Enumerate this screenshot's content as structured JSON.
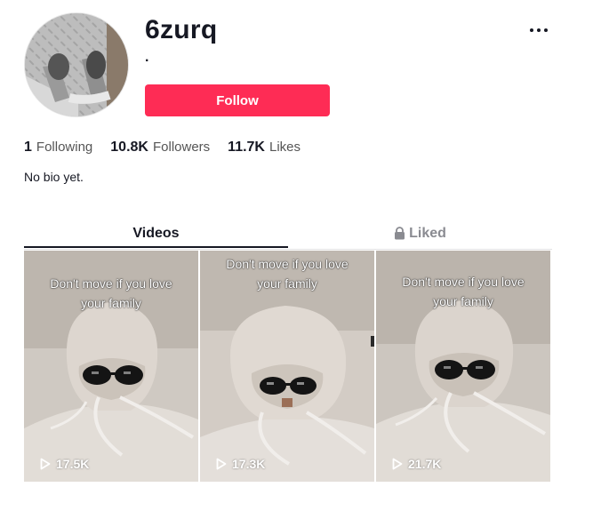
{
  "profile": {
    "username": "6zurq",
    "nickname": ".",
    "follow_label": "Follow",
    "bio": "No bio yet."
  },
  "stats": [
    {
      "value": "1",
      "label": "Following"
    },
    {
      "value": "10.8K",
      "label": "Followers"
    },
    {
      "value": "11.7K",
      "label": "Likes"
    }
  ],
  "tabs": {
    "videos": "Videos",
    "liked": "Liked"
  },
  "videos": [
    {
      "caption_line1": "Don't move if you love",
      "caption_line2": "your family",
      "views": "17.5K"
    },
    {
      "caption_line1": "Don't move if you love",
      "caption_line2": "your family",
      "views": "17.3K"
    },
    {
      "caption_line1": "Don't move if you love",
      "caption_line2": "your family",
      "views": "21.7K"
    }
  ],
  "icons": [
    "more-icon",
    "lock-icon",
    "play-icon"
  ],
  "colors": {
    "accent": "#fe2c55",
    "text": "#161823",
    "muted": "#8a8b91"
  }
}
